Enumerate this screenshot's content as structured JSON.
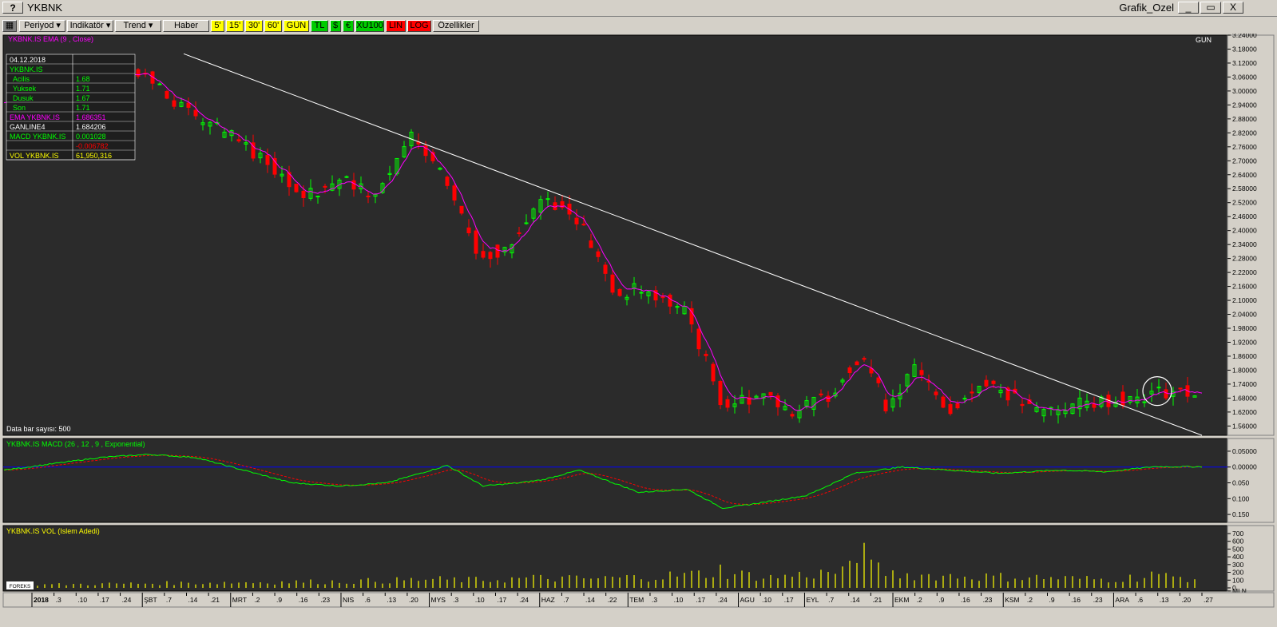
{
  "window": {
    "symbol": "YKBNK",
    "title_right": "Grafik_Ozel",
    "help": "?",
    "min": "_",
    "restore": "▭",
    "close": "X"
  },
  "toolbar": {
    "buttons": [
      {
        "label": "Periyod",
        "dropdown": true,
        "bg": "#d4d0c8",
        "fg": "#000000"
      },
      {
        "label": "Indikatör",
        "dropdown": true,
        "bg": "#d4d0c8",
        "fg": "#000000"
      },
      {
        "label": "Trend",
        "dropdown": true,
        "bg": "#d4d0c8",
        "fg": "#000000"
      },
      {
        "label": "Haber",
        "dropdown": false,
        "bg": "#d4d0c8",
        "fg": "#000000"
      },
      {
        "label": "5'",
        "dropdown": false,
        "bg": "#ffff00",
        "fg": "#000000"
      },
      {
        "label": "15'",
        "dropdown": false,
        "bg": "#ffff00",
        "fg": "#000000"
      },
      {
        "label": "30'",
        "dropdown": false,
        "bg": "#ffff00",
        "fg": "#000000"
      },
      {
        "label": "60'",
        "dropdown": false,
        "bg": "#ffff00",
        "fg": "#000000"
      },
      {
        "label": "GÜN",
        "dropdown": false,
        "bg": "#ffff00",
        "fg": "#000000"
      },
      {
        "label": "TL",
        "dropdown": false,
        "bg": "#00cc00",
        "fg": "#000000"
      },
      {
        "label": "$",
        "dropdown": false,
        "bg": "#00cc00",
        "fg": "#000000"
      },
      {
        "label": "€",
        "dropdown": false,
        "bg": "#00cc00",
        "fg": "#000000"
      },
      {
        "label": "XU100",
        "dropdown": false,
        "bg": "#00cc00",
        "fg": "#000000"
      },
      {
        "label": "LIN",
        "dropdown": false,
        "bg": "#ff0000",
        "fg": "#000000"
      },
      {
        "label": "LOG",
        "dropdown": false,
        "bg": "#ff0000",
        "fg": "#000000"
      },
      {
        "label": "Özellikler",
        "dropdown": false,
        "bg": "#d4d0c8",
        "fg": "#000000"
      }
    ]
  },
  "colors": {
    "background": "#2b2b2b",
    "up": "#00ff00",
    "down": "#ff0000",
    "ema": "#ff00ff",
    "trendline": "#ffffff",
    "macd": "#00ff00",
    "signal": "#ff0000",
    "zero": "#0000ff",
    "volume": "#ffff00"
  },
  "main_panel": {
    "title": "YKBNK.IS EMA (9 , Close)",
    "period_label": "GUN",
    "bar_count_label": "Data bar sayısı: 500",
    "info_rows": [
      {
        "label": "04.12.2018",
        "value": "",
        "color": "#ffffff"
      },
      {
        "label": "YKBNK.IS",
        "value": "",
        "color": "#00ff00"
      },
      {
        "label": "Acilis",
        "value": "1.68",
        "color": "#00ff00"
      },
      {
        "label": "Yuksek",
        "value": "1.71",
        "color": "#00ff00"
      },
      {
        "label": "Dusuk",
        "value": "1.67",
        "color": "#00ff00"
      },
      {
        "label": "Son",
        "value": "1.71",
        "color": "#00ff00"
      },
      {
        "label": "EMA YKBNK.IS",
        "value": "1.686351",
        "color": "#ff00ff"
      },
      {
        "label": "GANLINE4",
        "value": "1.684206",
        "color": "#ffffff"
      },
      {
        "label": "MACD YKBNK.IS",
        "value": "0.001028",
        "color": "#00ff00"
      },
      {
        "label": "",
        "value": "-0.006782",
        "color": "#ff0000"
      },
      {
        "label": "VOL YKBNK.IS",
        "value": "61,950,316",
        "color": "#ffff00"
      }
    ]
  },
  "chart_data": [
    {
      "type": "candlestick",
      "title": "YKBNK.IS EMA (9 , Close)",
      "ylim": [
        1.52,
        3.24
      ],
      "yticks": [
        "3.24000",
        "3.18000",
        "3.12000",
        "3.06000",
        "3.00000",
        "2.94000",
        "2.88000",
        "2.82000",
        "2.76000",
        "2.70000",
        "2.64000",
        "2.58000",
        "2.52000",
        "2.46000",
        "2.40000",
        "2.34000",
        "2.28000",
        "2.22000",
        "2.16000",
        "2.10000",
        "2.04000",
        "1.98000",
        "1.92000",
        "1.86000",
        "1.80000",
        "1.74000",
        "1.68000",
        "1.62000",
        "1.56000"
      ],
      "anchors_x_index": [
        0,
        25,
        40,
        55,
        75,
        95,
        110,
        125,
        140,
        155,
        170,
        185,
        198,
        210,
        225,
        240,
        255,
        265,
        285,
        300,
        318,
        330,
        345,
        358,
        368,
        380,
        395,
        410,
        430,
        442,
        458,
        470,
        485,
        500
      ],
      "anchors_close": [
        2.95,
        3.05,
        3.02,
        3.1,
        2.92,
        2.8,
        2.7,
        2.55,
        2.62,
        2.55,
        2.8,
        2.6,
        2.3,
        2.32,
        2.55,
        2.45,
        2.12,
        2.15,
        2.05,
        1.65,
        1.7,
        1.62,
        1.7,
        1.88,
        1.65,
        1.8,
        1.63,
        1.76,
        1.62,
        1.64,
        1.67,
        1.68,
        1.71,
        1.7
      ],
      "trendline": {
        "from": {
          "x_index": 75,
          "y": 3.16
        },
        "to": {
          "x_index": 500,
          "y": 1.52
        }
      },
      "highlight": {
        "x_index": 478,
        "y": 1.71
      }
    },
    {
      "type": "line",
      "title": "YKBNK.IS MACD (26 , 12 , 9 , Exponential)",
      "ylim": [
        -0.17,
        0.07
      ],
      "yticks": [
        "0.05000",
        "0.00000",
        "0.050",
        "0.100",
        "0.150"
      ],
      "anchors_x_index": [
        0,
        40,
        60,
        80,
        100,
        120,
        140,
        160,
        185,
        200,
        215,
        225,
        240,
        265,
        285,
        300,
        310,
        335,
        355,
        375,
        395,
        415,
        440,
        460,
        480
      ],
      "anchors_value": [
        -0.01,
        0.03,
        0.04,
        0.03,
        -0.01,
        -0.05,
        -0.06,
        -0.05,
        0.005,
        -0.06,
        -0.05,
        -0.04,
        -0.01,
        -0.08,
        -0.07,
        -0.13,
        -0.12,
        -0.09,
        -0.02,
        0.0,
        -0.01,
        -0.02,
        -0.01,
        -0.015,
        0.001
      ]
    },
    {
      "type": "bar",
      "title": "YKBNK.IS VOL (Islem Adedi)",
      "ylim": [
        0,
        700
      ],
      "yticks": [
        "700",
        "600",
        "500",
        "400",
        "300",
        "200",
        "100",
        "0",
        "MLN"
      ],
      "anchors_x_index": [
        0,
        50,
        100,
        140,
        180,
        200,
        220,
        245,
        270,
        300,
        320,
        345,
        360,
        370,
        385,
        410,
        430,
        460,
        480,
        500
      ],
      "anchors_value": [
        40,
        60,
        80,
        90,
        120,
        110,
        140,
        130,
        160,
        220,
        150,
        220,
        320,
        200,
        180,
        160,
        150,
        120,
        170,
        130
      ],
      "spikes": [
        {
          "x_index": 360,
          "value": 580
        },
        {
          "x_index": 299,
          "value": 300
        },
        {
          "x_index": 355,
          "value": 320
        },
        {
          "x_index": 480,
          "value": 210
        }
      ]
    }
  ],
  "x_axis": {
    "labels": [
      {
        "text": "2018",
        "bold": true
      },
      {
        "text": ".3"
      },
      {
        "text": ".10"
      },
      {
        "text": ".17"
      },
      {
        "text": ".24"
      },
      {
        "text": "ŞBT",
        "month": true
      },
      {
        "text": ".7"
      },
      {
        "text": ".14"
      },
      {
        "text": ".21"
      },
      {
        "text": "MRT",
        "month": true
      },
      {
        "text": ".2"
      },
      {
        "text": ".9"
      },
      {
        "text": ".16"
      },
      {
        "text": ".23"
      },
      {
        "text": "NIS",
        "month": true
      },
      {
        "text": ".6"
      },
      {
        "text": ".13"
      },
      {
        "text": ".20"
      },
      {
        "text": "MYS",
        "month": true
      },
      {
        "text": ".3"
      },
      {
        "text": ".10"
      },
      {
        "text": ".17"
      },
      {
        "text": ".24"
      },
      {
        "text": "HAZ",
        "month": true
      },
      {
        "text": ".7"
      },
      {
        "text": ".14"
      },
      {
        "text": ".22"
      },
      {
        "text": "TEM",
        "month": true
      },
      {
        "text": ".3"
      },
      {
        "text": ".10"
      },
      {
        "text": ".17"
      },
      {
        "text": ".24"
      },
      {
        "text": "AGU",
        "month": true
      },
      {
        "text": ".10"
      },
      {
        "text": ".17"
      },
      {
        "text": "EYL",
        "month": true
      },
      {
        "text": ".7"
      },
      {
        "text": ".14"
      },
      {
        "text": ".21"
      },
      {
        "text": "EKM",
        "month": true
      },
      {
        "text": ".2"
      },
      {
        "text": ".9"
      },
      {
        "text": ".16"
      },
      {
        "text": ".23"
      },
      {
        "text": "KSM",
        "month": true
      },
      {
        "text": ".2"
      },
      {
        "text": ".9"
      },
      {
        "text": ".16"
      },
      {
        "text": ".23"
      },
      {
        "text": "ARA",
        "month": true
      },
      {
        "text": ".6"
      },
      {
        "text": ".13"
      },
      {
        "text": ".20"
      },
      {
        "text": ".27"
      }
    ]
  },
  "logo_text": "FOREKS"
}
